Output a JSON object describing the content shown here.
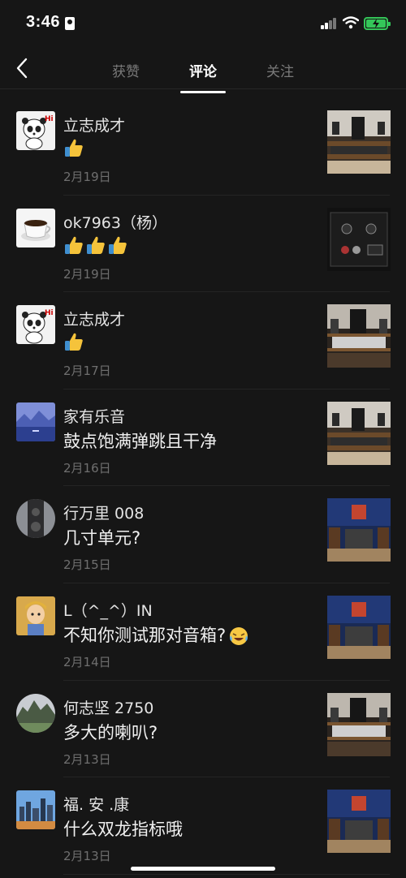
{
  "status_bar": {
    "time": "3:46"
  },
  "nav": {
    "tabs": [
      {
        "label": "获赞",
        "active": false
      },
      {
        "label": "评论",
        "active": true
      },
      {
        "label": "关注",
        "active": false
      }
    ]
  },
  "comments": [
    {
      "name": "立志成才",
      "text": "",
      "emoji": [
        "thumbs-up"
      ],
      "date": "2月19日",
      "avatar": "panda-hi",
      "thumb": "hifi-room-wide"
    },
    {
      "name": "ok7963（杨）",
      "text": "",
      "emoji": [
        "thumbs-up",
        "thumbs-up",
        "thumbs-up"
      ],
      "date": "2月19日",
      "avatar": "coffee-cup",
      "thumb": "amplifier-panel"
    },
    {
      "name": "立志成才",
      "text": "",
      "emoji": [
        "thumbs-up"
      ],
      "date": "2月17日",
      "avatar": "panda-hi",
      "thumb": "hifi-room-shelf"
    },
    {
      "name": "家有乐音",
      "text": "鼓点饱满弹跳且干净",
      "emoji": [],
      "date": "2月16日",
      "avatar": "lake-landscape",
      "thumb": "hifi-room-wide"
    },
    {
      "name": "行万里 008",
      "text": "几寸单元?",
      "emoji": [],
      "date": "2月15日",
      "avatar": "speaker-closeup",
      "thumb": "showroom-poster"
    },
    {
      "name": "L（^_^）IN",
      "text": "不知你测试那对音箱?",
      "emoji": [
        "laughing-crying-face"
      ],
      "date": "2月14日",
      "avatar": "cartoon-boy",
      "thumb": "showroom-poster"
    },
    {
      "name": "何志坚 2750",
      "text": "多大的喇叭?",
      "emoji": [],
      "date": "2月13日",
      "avatar": "mountain-landscape",
      "thumb": "hifi-room-shelf"
    },
    {
      "name": "福. 安 .康",
      "text": "什么双龙指标哦",
      "emoji": [],
      "date": "2月13日",
      "avatar": "city-skyline",
      "thumb": "showroom-poster"
    }
  ],
  "colors": {
    "background": "#161616",
    "active_tab": "#ffffff",
    "inactive_tab": "#7a7a7a",
    "date_text": "#6f6f6f",
    "battery": "#34c759"
  }
}
